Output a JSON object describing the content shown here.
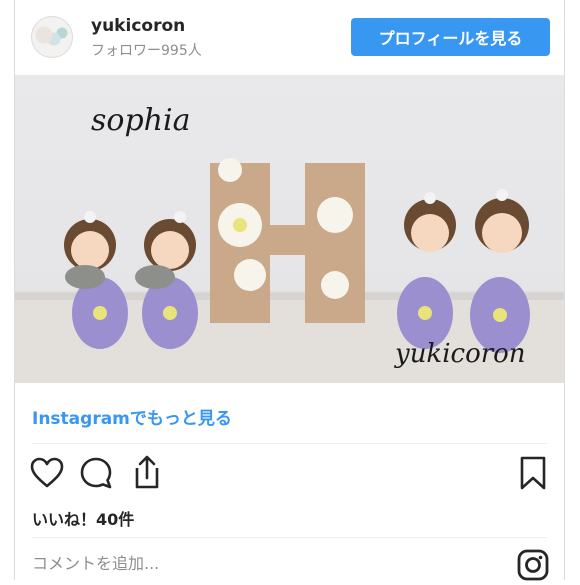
{
  "header": {
    "username": "yukicoron",
    "followers": "フォロワー995人",
    "profile_button": "プロフィールを見る"
  },
  "photo": {
    "caption_top": "sophia",
    "caption_bottom": "yukicoron"
  },
  "more_link": "Instagramでもっと見る",
  "likes": "いいね！40件",
  "comment": {
    "placeholder": "コメントを追加..."
  },
  "colors": {
    "accent": "#3897f0",
    "text": "#262626",
    "muted": "#8e8e8e"
  },
  "icons": [
    "heart-icon",
    "comment-icon",
    "share-icon",
    "bookmark-icon",
    "instagram-logo-icon"
  ]
}
